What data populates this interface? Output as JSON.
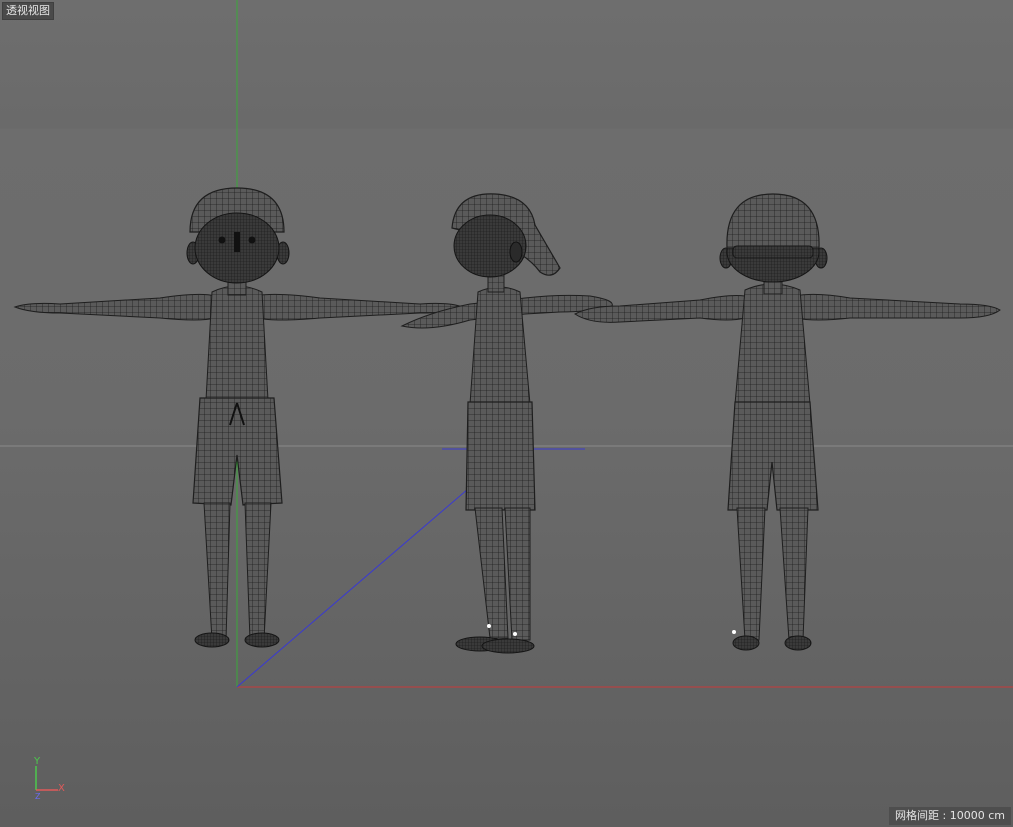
{
  "viewport": {
    "label": "透视视图",
    "grid_spacing": "网格间距 : 10000 cm"
  },
  "gizmo": {
    "y": "Y",
    "x": "X",
    "z": "Z"
  },
  "colors": {
    "x_axis": "#c83a3a",
    "y_axis": "#3aa83a",
    "z_axis": "#3a3ad0",
    "mesh_wire": "#1e1e1e",
    "mesh_fill": "#5c5c5c"
  },
  "models": [
    {
      "name": "boy-front-view",
      "icon": "character-mesh"
    },
    {
      "name": "boy-side-view",
      "icon": "character-mesh"
    },
    {
      "name": "boy-back-view",
      "icon": "character-mesh"
    }
  ]
}
